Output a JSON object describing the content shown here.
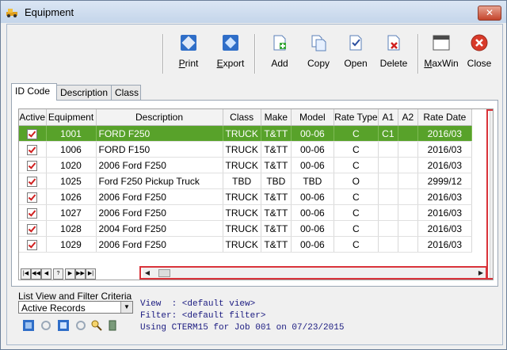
{
  "window": {
    "title": "Equipment",
    "close_symbol": "✕"
  },
  "toolbar": {
    "buttons": [
      {
        "label": "Print",
        "ul": "P",
        "rest": "rint",
        "icon": "print-icon"
      },
      {
        "label": "Export",
        "ul": "E",
        "rest": "xport",
        "icon": "export-icon"
      },
      {
        "label": "Add",
        "icon": "add-icon"
      },
      {
        "label": "Copy",
        "icon": "copy-icon"
      },
      {
        "label": "Open",
        "icon": "open-icon"
      },
      {
        "label": "Delete",
        "icon": "delete-icon"
      },
      {
        "label": "MaxWin",
        "ul": "M",
        "rest": "axWin",
        "icon": "maxwin-icon"
      },
      {
        "label": "Close",
        "icon": "close-icon"
      }
    ]
  },
  "tabs": [
    "ID Code",
    "Description",
    "Class"
  ],
  "grid": {
    "columns": [
      "Active",
      "Equipment",
      "Description",
      "Class",
      "Make",
      "Model",
      "Rate Type",
      "A1",
      "A2",
      "Rate Date"
    ],
    "rows": [
      {
        "active": true,
        "equipment": "1001",
        "description": "FORD F250",
        "class": "TRUCK",
        "make": "T&TT",
        "model": "00-06",
        "rate_type": "C",
        "a1": "C1",
        "a2": "",
        "rate_date": "2016/03",
        "selected": true
      },
      {
        "active": true,
        "equipment": "1006",
        "description": "FORD F150",
        "class": "TRUCK",
        "make": "T&TT",
        "model": "00-06",
        "rate_type": "C",
        "a1": "",
        "a2": "",
        "rate_date": "2016/03"
      },
      {
        "active": true,
        "equipment": "1020",
        "description": "2006 Ford F250",
        "class": "TRUCK",
        "make": "T&TT",
        "model": "00-06",
        "rate_type": "C",
        "a1": "",
        "a2": "",
        "rate_date": "2016/03"
      },
      {
        "active": true,
        "equipment": "1025",
        "description": "Ford F250 Pickup Truck",
        "class": "TBD",
        "make": "TBD",
        "model": "TBD",
        "rate_type": "O",
        "a1": "",
        "a2": "",
        "rate_date": "2999/12"
      },
      {
        "active": true,
        "equipment": "1026",
        "description": "2006 Ford F250",
        "class": "TRUCK",
        "make": "T&TT",
        "model": "00-06",
        "rate_type": "C",
        "a1": "",
        "a2": "",
        "rate_date": "2016/03"
      },
      {
        "active": true,
        "equipment": "1027",
        "description": "2006 Ford F250",
        "class": "TRUCK",
        "make": "T&TT",
        "model": "00-06",
        "rate_type": "C",
        "a1": "",
        "a2": "",
        "rate_date": "2016/03"
      },
      {
        "active": true,
        "equipment": "1028",
        "description": "2004 Ford F250",
        "class": "TRUCK",
        "make": "T&TT",
        "model": "00-06",
        "rate_type": "C",
        "a1": "",
        "a2": "",
        "rate_date": "2016/03"
      },
      {
        "active": true,
        "equipment": "1029",
        "description": "2006 Ford F250",
        "class": "TRUCK",
        "make": "T&TT",
        "model": "00-06",
        "rate_type": "C",
        "a1": "",
        "a2": "",
        "rate_date": "2016/03"
      }
    ],
    "nav_buttons": [
      "|◀",
      "◀◀",
      "◀",
      "?",
      "▶",
      "▶▶",
      "▶|"
    ],
    "highlight_color": "#d9333a",
    "selected_row_color": "#58a22a"
  },
  "filter": {
    "label": "List View and Filter Criteria",
    "selected": "Active Records",
    "view_line": "View  : <default view>",
    "filter_line": "Filter: <default filter>",
    "using_line": "Using CTERM15 for Job 001 on 07/23/2015"
  }
}
